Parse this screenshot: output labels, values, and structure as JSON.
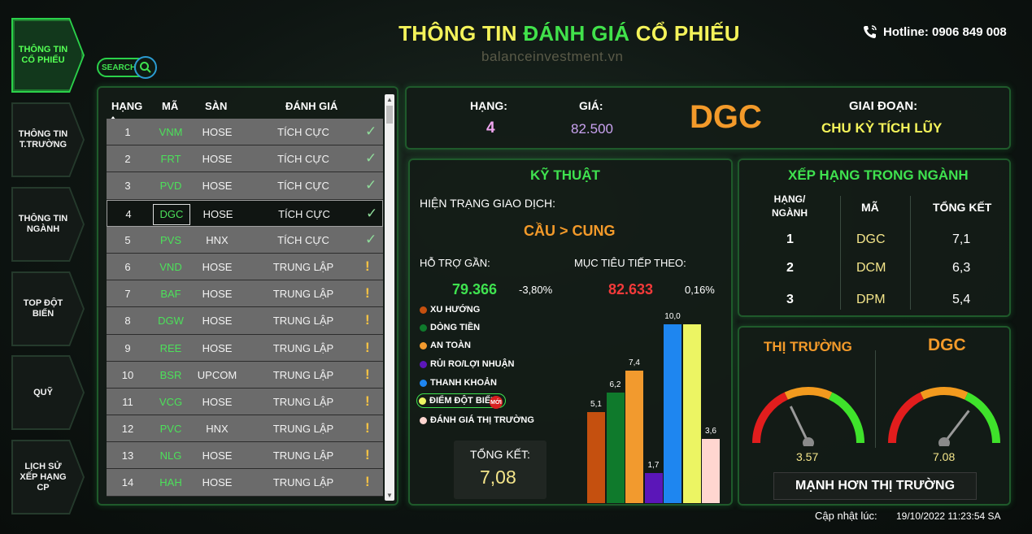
{
  "title_part1": "THÔNG TIN ",
  "title_part2": "ĐÁNH GIÁ ",
  "title_part3": "CỔ PHIẾU",
  "watermark": "balanceinvestment.vn",
  "hotline": "Hotline: 0906 849 008",
  "search_label": "SEARCH",
  "nav": [
    {
      "label": "THÔNG TIN CỔ PHIẾU"
    },
    {
      "label": "THÔNG TIN T.TRƯỜNG"
    },
    {
      "label": "THÔNG TIN NGÀNH"
    },
    {
      "label": "TOP ĐỘT BIẾN"
    },
    {
      "label": "QUỸ"
    },
    {
      "label": "LỊCH SỬ XẾP HẠNG CP"
    }
  ],
  "table": {
    "headers": {
      "rank": "HẠNG",
      "code": "MÃ",
      "exchange": "SÀN",
      "rating": "ĐÁNH GIÁ"
    },
    "rows": [
      {
        "rank": "1",
        "code": "VNM",
        "exchange": "HOSE",
        "rating": "TÍCH CỰC",
        "icon": "check-icon"
      },
      {
        "rank": "2",
        "code": "FRT",
        "exchange": "HOSE",
        "rating": "TÍCH CỰC",
        "icon": "check-icon"
      },
      {
        "rank": "3",
        "code": "PVD",
        "exchange": "HOSE",
        "rating": "TÍCH CỰC",
        "icon": "check-icon"
      },
      {
        "rank": "4",
        "code": "DGC",
        "exchange": "HOSE",
        "rating": "TÍCH CỰC",
        "icon": "check-icon"
      },
      {
        "rank": "5",
        "code": "PVS",
        "exchange": "HNX",
        "rating": "TÍCH CỰC",
        "icon": "check-icon"
      },
      {
        "rank": "6",
        "code": "VND",
        "exchange": "HOSE",
        "rating": "TRUNG LẬP",
        "icon": "warning-icon"
      },
      {
        "rank": "7",
        "code": "BAF",
        "exchange": "HOSE",
        "rating": "TRUNG LẬP",
        "icon": "warning-icon"
      },
      {
        "rank": "8",
        "code": "DGW",
        "exchange": "HOSE",
        "rating": "TRUNG LẬP",
        "icon": "warning-icon"
      },
      {
        "rank": "9",
        "code": "REE",
        "exchange": "HOSE",
        "rating": "TRUNG LẬP",
        "icon": "warning-icon"
      },
      {
        "rank": "10",
        "code": "BSR",
        "exchange": "UPCOM",
        "rating": "TRUNG LẬP",
        "icon": "warning-icon"
      },
      {
        "rank": "11",
        "code": "VCG",
        "exchange": "HOSE",
        "rating": "TRUNG LẬP",
        "icon": "warning-icon"
      },
      {
        "rank": "12",
        "code": "PVC",
        "exchange": "HNX",
        "rating": "TRUNG LẬP",
        "icon": "warning-icon"
      },
      {
        "rank": "13",
        "code": "NLG",
        "exchange": "HOSE",
        "rating": "TRUNG LẬP",
        "icon": "warning-icon"
      },
      {
        "rank": "14",
        "code": "HAH",
        "exchange": "HOSE",
        "rating": "TRUNG LẬP",
        "icon": "warning-icon"
      }
    ]
  },
  "info": {
    "rank_label": "HẠNG:",
    "rank_value": "4",
    "price_label": "GIÁ:",
    "price_value": "82.500",
    "ticker": "DGC",
    "phase_label": "GIAI ĐOẠN:",
    "phase_value": "CHU KỲ TÍCH LŨY"
  },
  "tech": {
    "title": "KỸ THUẬT",
    "status_label": "HIỆN TRẠNG GIAO DỊCH:",
    "status_value": "CẦU > CUNG",
    "support_label": "HỖ TRỢ GẦN:",
    "support_value": "79.366",
    "support_pct": "-3,80%",
    "target_label": "MỤC TIÊU TIẾP THEO:",
    "target_value": "82.633",
    "target_pct": "0,16%",
    "total_label": "TỔNG KẾT:",
    "total_value": "7,08",
    "new_badge": "MỚI"
  },
  "chart_data": {
    "type": "bar",
    "categories": [
      "XU HƯỚNG",
      "DÒNG TIỀN",
      "AN TOÀN",
      "RỦI RO/LỢI NHUẬN",
      "THANH KHOẢN",
      "ĐIỂM ĐỘT BIẾN",
      "ĐÁNH GIÁ THỊ TRƯỜNG"
    ],
    "values": [
      5.1,
      6.2,
      7.4,
      1.7,
      10.0,
      10.0,
      3.6
    ],
    "value_labels": [
      "5,1",
      "6,2",
      "7,4",
      "1,7",
      "10,0",
      "",
      "3,6"
    ],
    "colors": [
      "#c5500f",
      "#0f7a2c",
      "#f29a2e",
      "#5b16b8",
      "#1e86f0",
      "#ecf563",
      "#ffd6d0"
    ],
    "ylim": [
      0,
      10
    ],
    "legend_position": "left"
  },
  "ranking": {
    "title": "XẾP HẠNG TRONG NGÀNH",
    "headers": {
      "rank": "HẠNG/ NGÀNH",
      "code": "MÃ",
      "total": "TỔNG KẾT"
    },
    "rows": [
      {
        "rank": "1",
        "code": "DGC",
        "total": "7,1"
      },
      {
        "rank": "2",
        "code": "DCM",
        "total": "6,3"
      },
      {
        "rank": "3",
        "code": "DPM",
        "total": "5,4"
      }
    ]
  },
  "gauges": {
    "market_label": "THỊ TRƯỜNG",
    "market_value": "3.57",
    "market_level": 0.357,
    "stock_label": "DGC",
    "stock_value": "7.08",
    "stock_level": 0.708,
    "verdict": "MẠNH HƠN THỊ TRƯỜNG"
  },
  "update_label": "Cập nhật lúc:",
  "update_time": "19/10/2022 11:23:54 SA"
}
